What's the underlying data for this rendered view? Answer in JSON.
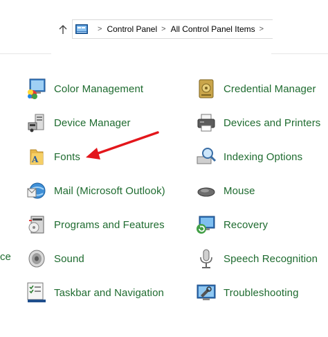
{
  "address_bar": {
    "breadcrumbs": [
      "Control Panel",
      "All Control Panel Items"
    ],
    "separator": ">",
    "icons": [
      "up-arrow-icon",
      "control-panel-icon"
    ]
  },
  "left_column": [
    {
      "label": "Color Management",
      "icon": "color-management-icon"
    },
    {
      "label": "Device Manager",
      "icon": "device-manager-icon"
    },
    {
      "label": "Fonts",
      "icon": "fonts-folder-icon"
    },
    {
      "label": "Mail (Microsoft Outlook)",
      "icon": "mail-icon"
    },
    {
      "label": "Programs and Features",
      "icon": "programs-features-icon"
    },
    {
      "label": "Sound",
      "icon": "speaker-icon"
    },
    {
      "label": "Taskbar and Navigation",
      "icon": "taskbar-icon"
    }
  ],
  "right_column": [
    {
      "label": "Credential Manager",
      "icon": "credential-manager-icon"
    },
    {
      "label": "Devices and Printers",
      "icon": "printer-icon"
    },
    {
      "label": "Indexing Options",
      "icon": "indexing-icon"
    },
    {
      "label": "Mouse",
      "icon": "mouse-icon"
    },
    {
      "label": "Recovery",
      "icon": "recovery-icon"
    },
    {
      "label": "Speech Recognition",
      "icon": "microphone-icon"
    },
    {
      "label": "Troubleshooting",
      "icon": "troubleshooting-icon"
    }
  ],
  "partial_left_label": "ce",
  "colors": {
    "link_text": "#1e6b2f",
    "annotation_arrow": "#e3161b"
  }
}
